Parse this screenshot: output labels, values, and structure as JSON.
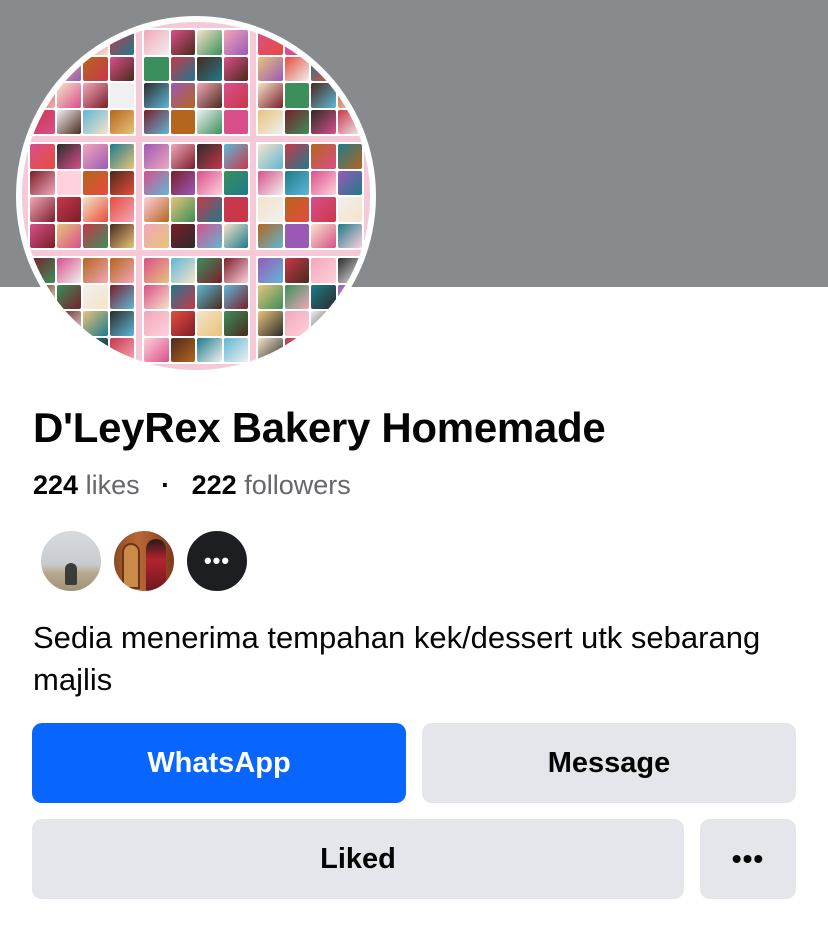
{
  "cover": {
    "color": "#878b8e"
  },
  "page": {
    "name": "D'LeyRex Bakery Homemade",
    "likes_count": "224",
    "likes_label": "likes",
    "separator": "·",
    "followers_count": "222",
    "followers_label": "followers",
    "bio": "Sedia menerima tempahan kek/dessert utk sebarang majlis"
  },
  "friends": {
    "avatars": [
      "friend-avatar-1",
      "friend-avatar-2"
    ],
    "more_label": "•••"
  },
  "actions": {
    "whatsapp_label": "WhatsApp",
    "message_label": "Message",
    "liked_label": "Liked",
    "more_label": "•••"
  },
  "colors": {
    "primary": "#0866ff",
    "secondary_bg": "#e4e6eb",
    "text": "#050505",
    "muted": "#65676b"
  }
}
